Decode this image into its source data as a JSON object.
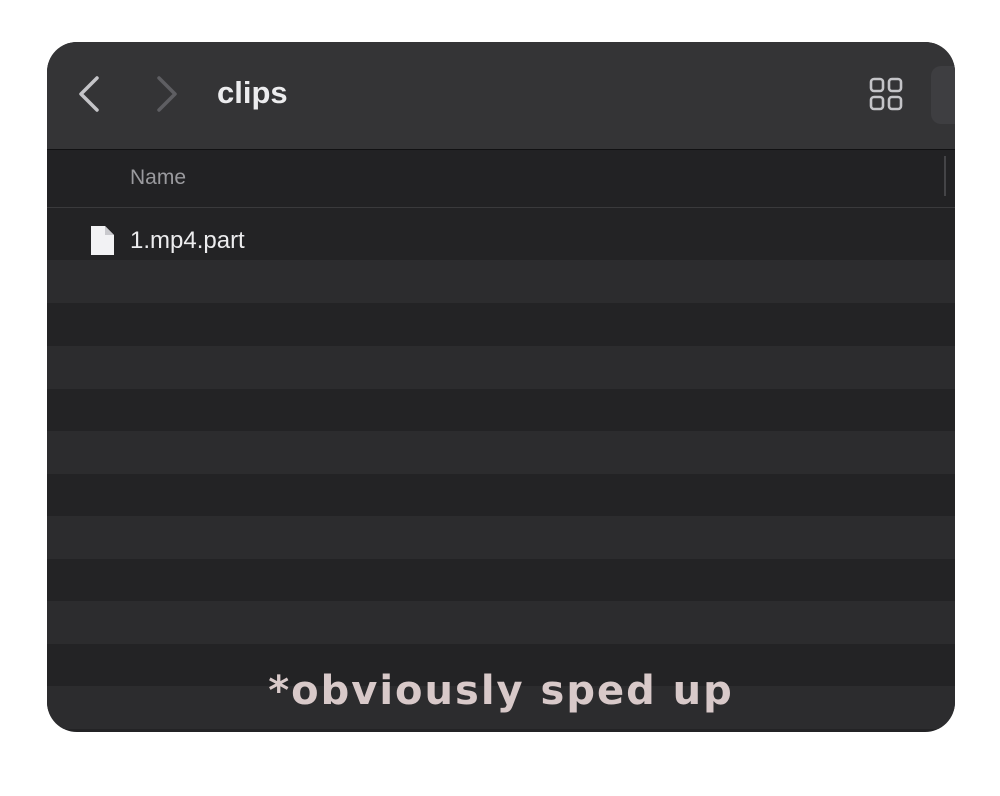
{
  "window": {
    "title": "clips"
  },
  "toolbar": {
    "back_icon": "chevron-left-icon",
    "forward_icon": "chevron-right-icon",
    "view_icon": "grid-view-icon"
  },
  "list": {
    "column_header": "Name",
    "files": [
      {
        "name": "1.mp4.part",
        "icon": "document-icon"
      }
    ]
  },
  "overlay": {
    "caption": "*obviously sped up"
  },
  "colors": {
    "window_bg": "#232325",
    "toolbar_bg": "#343436",
    "stripe": "#2c2c2e",
    "text": "#ececee",
    "caption": "#d8c9c9"
  }
}
